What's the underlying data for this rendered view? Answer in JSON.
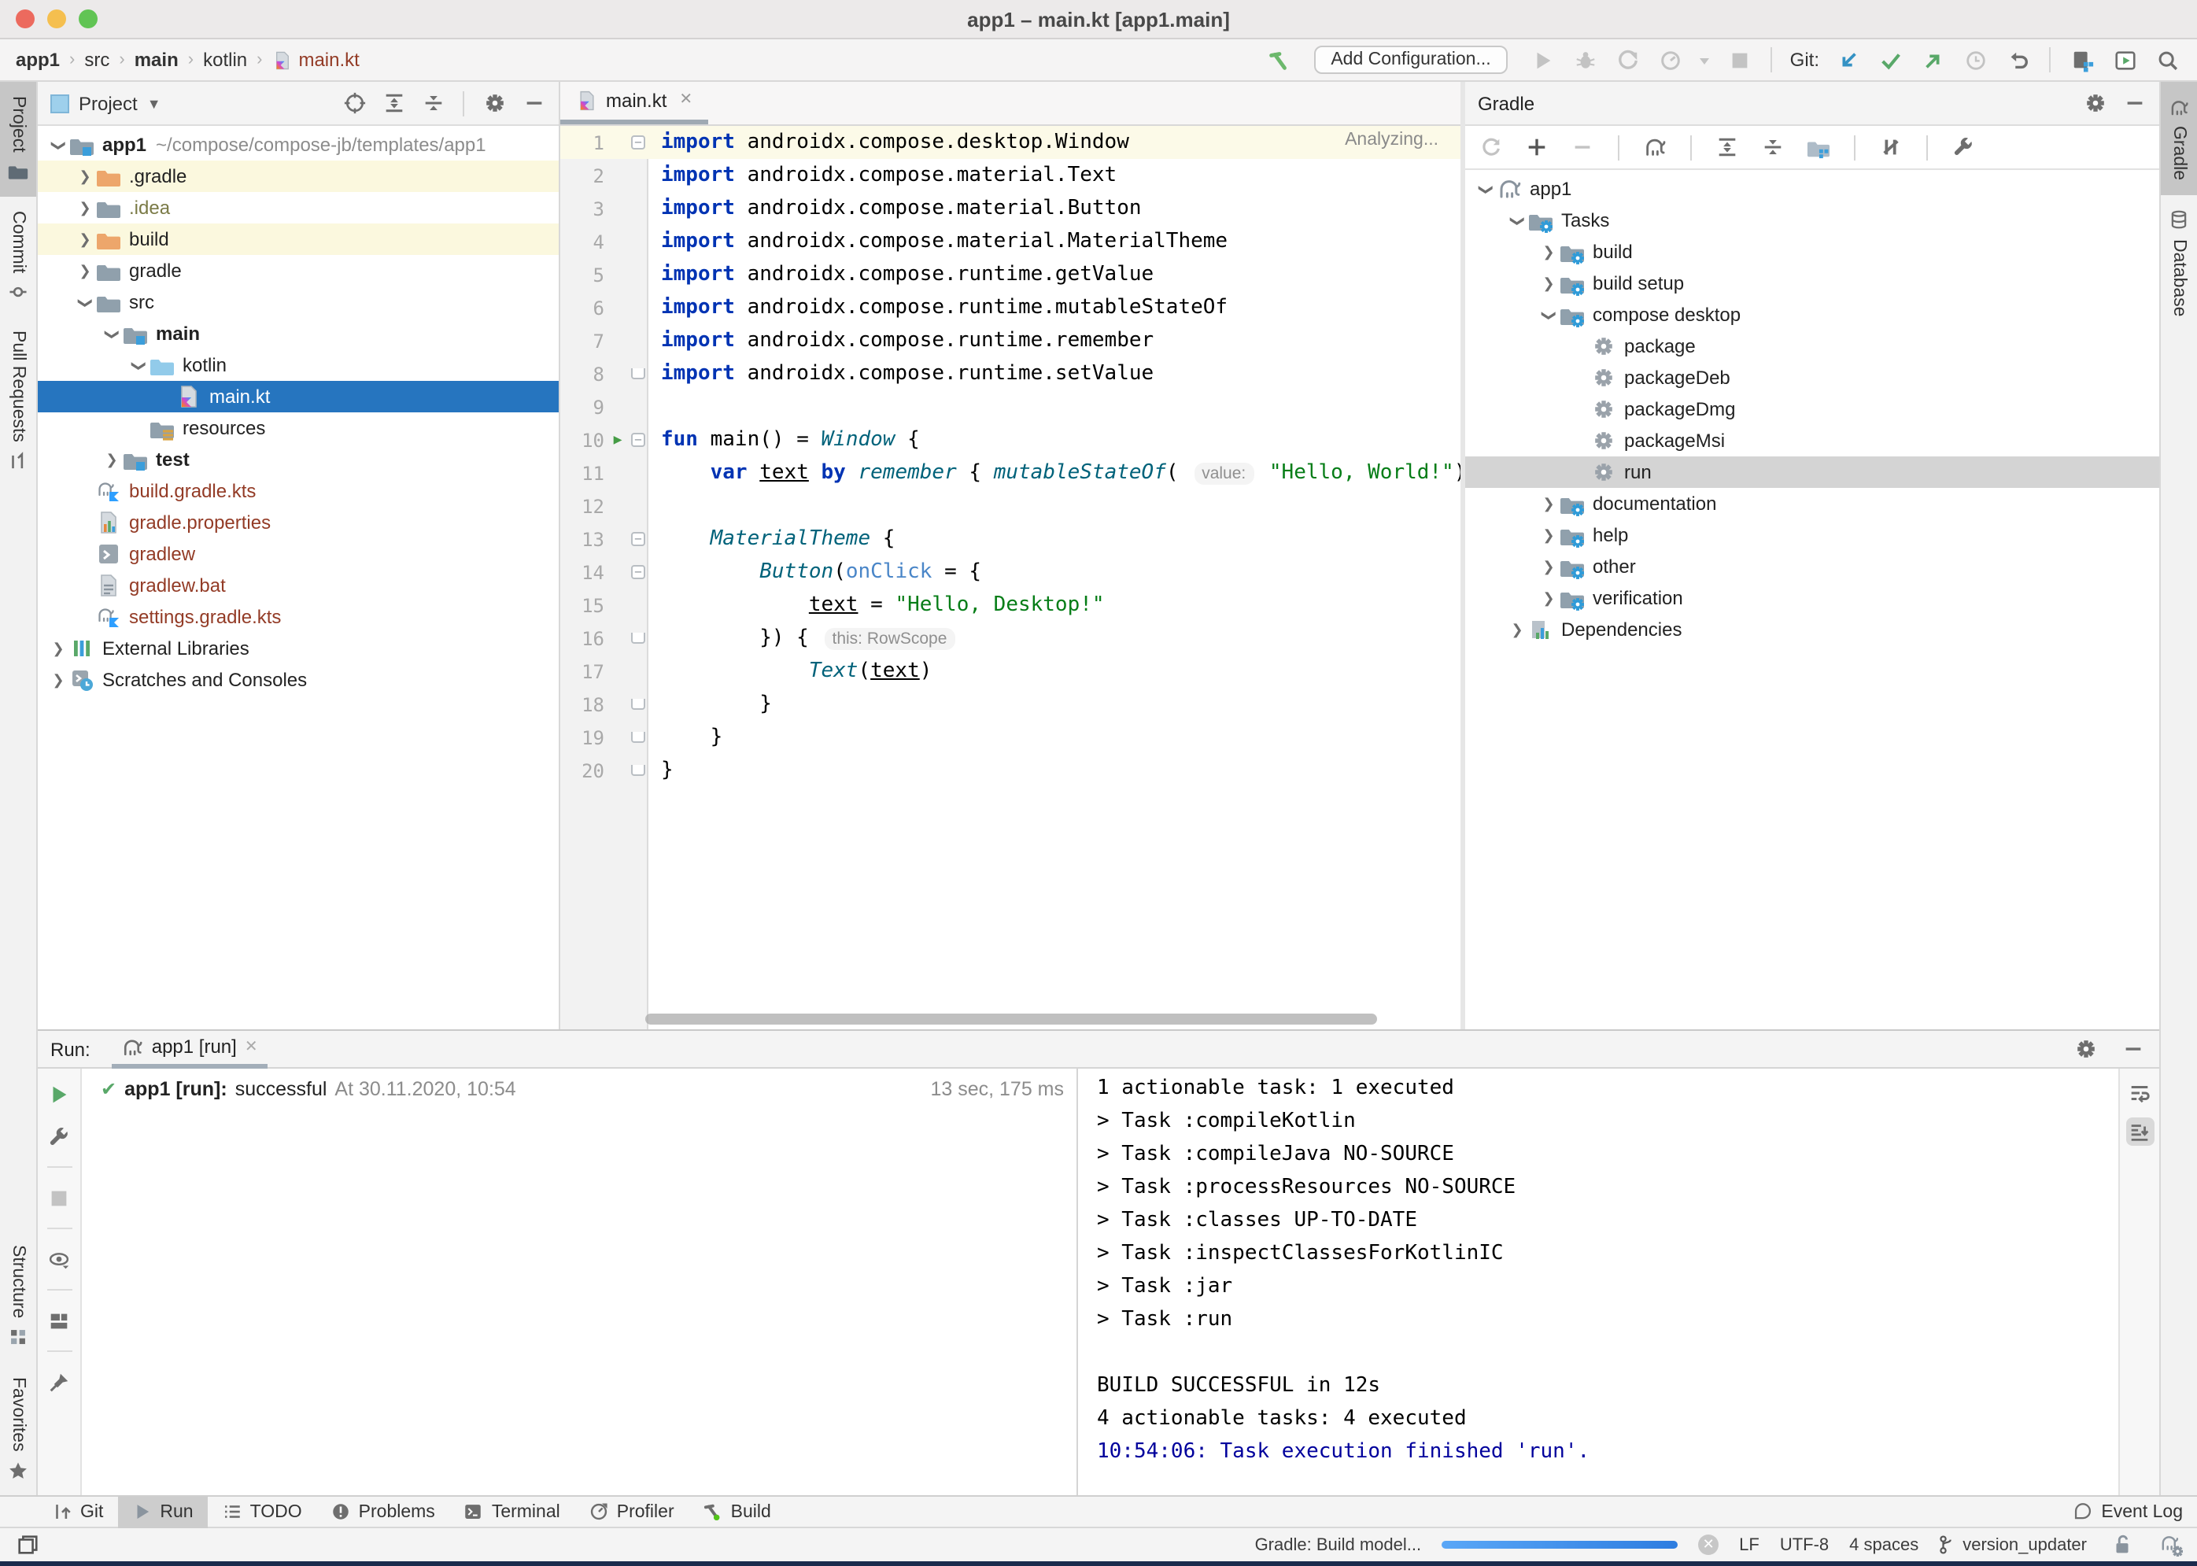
{
  "window": {
    "title": "app1 – main.kt [app1.main]"
  },
  "navbar": {
    "breadcrumbs": [
      {
        "label": "app1",
        "bold": true
      },
      {
        "label": "src",
        "bold": false
      },
      {
        "label": "main",
        "bold": true
      },
      {
        "label": "kotlin",
        "bold": false
      },
      {
        "label": "main.kt",
        "bold": false,
        "icon": "kotlin-file",
        "colored": true
      }
    ],
    "add_configuration": "Add Configuration...",
    "git_label": "Git:"
  },
  "left_stripe": {
    "top": [
      {
        "label": "Project",
        "icon": "tool-project-icon",
        "active": true
      },
      {
        "label": "Commit",
        "icon": "tool-commit-icon",
        "active": false
      },
      {
        "label": "Pull Requests",
        "icon": "tool-pr-icon",
        "active": false
      }
    ],
    "bottom": [
      {
        "label": "Structure",
        "icon": "tool-structure-icon",
        "active": false
      },
      {
        "label": "Favorites",
        "icon": "tool-star-icon",
        "active": false
      }
    ]
  },
  "right_stripe": [
    {
      "label": "Gradle",
      "icon": "gradle-elephant-icon",
      "active": true
    },
    {
      "label": "Database",
      "icon": "tool-database-icon",
      "active": false
    }
  ],
  "project_panel": {
    "title": "Project",
    "tree": [
      {
        "depth": 0,
        "chevron": "open",
        "icon": "folder-project",
        "label": "app1",
        "bold": true,
        "suffix": "~/compose/compose-jb/templates/app1"
      },
      {
        "depth": 1,
        "chevron": "closed",
        "icon": "folder-orange",
        "label": ".gradle",
        "bg": "y"
      },
      {
        "depth": 1,
        "chevron": "closed",
        "icon": "folder-gray",
        "label": ".idea",
        "color": "olive"
      },
      {
        "depth": 1,
        "chevron": "closed",
        "icon": "folder-orange",
        "label": "build",
        "bg": "y"
      },
      {
        "depth": 1,
        "chevron": "closed",
        "icon": "folder-gray",
        "label": "gradle"
      },
      {
        "depth": 1,
        "chevron": "open",
        "icon": "folder-gray",
        "label": "src"
      },
      {
        "depth": 2,
        "chevron": "open",
        "icon": "folder-main",
        "label": "main",
        "bold": true
      },
      {
        "depth": 3,
        "chevron": "open",
        "icon": "folder-kotlin",
        "label": "kotlin"
      },
      {
        "depth": 4,
        "chevron": "none",
        "icon": "kotlin-file",
        "label": "main.kt",
        "selected": true
      },
      {
        "depth": 3,
        "chevron": "none",
        "icon": "folder-resources",
        "label": "resources"
      },
      {
        "depth": 2,
        "chevron": "closed",
        "icon": "folder-main",
        "label": "test",
        "bold": true
      },
      {
        "depth": 1,
        "chevron": "none",
        "icon": "gradle-kts-file",
        "label": "build.gradle.kts",
        "color": "brick"
      },
      {
        "depth": 1,
        "chevron": "none",
        "icon": "properties-file",
        "label": "gradle.properties",
        "color": "brick"
      },
      {
        "depth": 1,
        "chevron": "none",
        "icon": "console-file",
        "label": "gradlew",
        "color": "brick"
      },
      {
        "depth": 1,
        "chevron": "none",
        "icon": "text-file",
        "label": "gradlew.bat",
        "color": "brick"
      },
      {
        "depth": 1,
        "chevron": "none",
        "icon": "gradle-kts-file",
        "label": "settings.gradle.kts",
        "color": "brick"
      },
      {
        "depth": 0,
        "chevron": "closed",
        "icon": "libraries",
        "label": "External Libraries"
      },
      {
        "depth": 0,
        "chevron": "closed",
        "icon": "scratches",
        "label": "Scratches and Consoles"
      }
    ]
  },
  "editor": {
    "tab": {
      "label": "main.kt",
      "icon": "kotlin-file"
    },
    "analyzing": "Analyzing...",
    "lines": [
      {
        "num": 1,
        "fold": "s",
        "current": true,
        "segs": [
          [
            "k",
            "import"
          ],
          [
            "p",
            " androidx.compose.desktop.Window"
          ]
        ]
      },
      {
        "num": 2,
        "segs": [
          [
            "k",
            "import"
          ],
          [
            "p",
            " androidx.compose.material.Text"
          ]
        ]
      },
      {
        "num": 3,
        "segs": [
          [
            "k",
            "import"
          ],
          [
            "p",
            " androidx.compose.material.Button"
          ]
        ]
      },
      {
        "num": 4,
        "segs": [
          [
            "k",
            "import"
          ],
          [
            "p",
            " androidx.compose.material.MaterialTheme"
          ]
        ]
      },
      {
        "num": 5,
        "segs": [
          [
            "k",
            "import"
          ],
          [
            "p",
            " androidx.compose.runtime.getValue"
          ]
        ]
      },
      {
        "num": 6,
        "segs": [
          [
            "k",
            "import"
          ],
          [
            "p",
            " androidx.compose.runtime.mutableStateOf"
          ]
        ]
      },
      {
        "num": 7,
        "segs": [
          [
            "k",
            "import"
          ],
          [
            "p",
            " androidx.compose.runtime.remember"
          ]
        ]
      },
      {
        "num": 8,
        "fold": "e",
        "segs": [
          [
            "k",
            "import"
          ],
          [
            "p",
            " androidx.compose.runtime.setValue"
          ]
        ]
      },
      {
        "num": 9,
        "segs": []
      },
      {
        "num": 10,
        "run": true,
        "fold": "s",
        "segs": [
          [
            "k",
            "fun"
          ],
          [
            "p",
            " main() = "
          ],
          [
            "fn",
            "Window"
          ],
          [
            "p",
            " {"
          ]
        ]
      },
      {
        "num": 11,
        "segs": [
          [
            "p",
            "    "
          ],
          [
            "k",
            "var"
          ],
          [
            "p",
            " "
          ],
          [
            "u",
            "text"
          ],
          [
            "p",
            " "
          ],
          [
            "k",
            "by"
          ],
          [
            "p",
            " "
          ],
          [
            "fn",
            "remember"
          ],
          [
            "p",
            " { "
          ],
          [
            "fn",
            "mutableStateOf"
          ],
          [
            "p",
            "( "
          ],
          [
            "chip",
            "value:"
          ],
          [
            "p",
            " "
          ],
          [
            "s",
            "\"Hello, World!\""
          ],
          [
            "p",
            ")"
          ]
        ]
      },
      {
        "num": 12,
        "segs": []
      },
      {
        "num": 13,
        "fold": "s",
        "segs": [
          [
            "p",
            "    "
          ],
          [
            "fn",
            "MaterialTheme"
          ],
          [
            "p",
            " {"
          ]
        ]
      },
      {
        "num": 14,
        "fold": "s",
        "segs": [
          [
            "p",
            "        "
          ],
          [
            "fn",
            "Button"
          ],
          [
            "p",
            "("
          ],
          [
            "np",
            "onClick"
          ],
          [
            "p",
            " = {"
          ]
        ]
      },
      {
        "num": 15,
        "segs": [
          [
            "p",
            "            "
          ],
          [
            "u",
            "text"
          ],
          [
            "p",
            " = "
          ],
          [
            "s",
            "\"Hello, Desktop!\""
          ]
        ]
      },
      {
        "num": 16,
        "fold": "e",
        "segs": [
          [
            "p",
            "        }) { "
          ],
          [
            "chip",
            "this: RowScope"
          ]
        ]
      },
      {
        "num": 17,
        "segs": [
          [
            "p",
            "            "
          ],
          [
            "fn",
            "Text"
          ],
          [
            "p",
            "("
          ],
          [
            "u",
            "text"
          ],
          [
            "p",
            ")"
          ]
        ]
      },
      {
        "num": 18,
        "fold": "e",
        "segs": [
          [
            "p",
            "        }"
          ]
        ]
      },
      {
        "num": 19,
        "fold": "e",
        "segs": [
          [
            "p",
            "    }"
          ]
        ]
      },
      {
        "num": 20,
        "fold": "e",
        "segs": [
          [
            "p",
            "}"
          ]
        ]
      }
    ]
  },
  "gradle_panel": {
    "title": "Gradle",
    "tree": [
      {
        "depth": 0,
        "chevron": "open",
        "icon": "gradle-elephant",
        "label": "app1"
      },
      {
        "depth": 1,
        "chevron": "open",
        "icon": "folder-taskgroup",
        "label": "Tasks"
      },
      {
        "depth": 2,
        "chevron": "closed",
        "icon": "folder-taskgroup",
        "label": "build"
      },
      {
        "depth": 2,
        "chevron": "closed",
        "icon": "folder-taskgroup",
        "label": "build setup"
      },
      {
        "depth": 2,
        "chevron": "open",
        "icon": "folder-taskgroup",
        "label": "compose desktop"
      },
      {
        "depth": 3,
        "chevron": "none",
        "icon": "task-gear",
        "label": "package"
      },
      {
        "depth": 3,
        "chevron": "none",
        "icon": "task-gear",
        "label": "packageDeb"
      },
      {
        "depth": 3,
        "chevron": "none",
        "icon": "task-gear",
        "label": "packageDmg"
      },
      {
        "depth": 3,
        "chevron": "none",
        "icon": "task-gear",
        "label": "packageMsi"
      },
      {
        "depth": 3,
        "chevron": "none",
        "icon": "task-gear",
        "label": "run",
        "selected_gray": true
      },
      {
        "depth": 2,
        "chevron": "closed",
        "icon": "folder-taskgroup",
        "label": "documentation"
      },
      {
        "depth": 2,
        "chevron": "closed",
        "icon": "folder-taskgroup",
        "label": "help"
      },
      {
        "depth": 2,
        "chevron": "closed",
        "icon": "folder-taskgroup",
        "label": "other"
      },
      {
        "depth": 2,
        "chevron": "closed",
        "icon": "folder-taskgroup",
        "label": "verification"
      },
      {
        "depth": 1,
        "chevron": "closed",
        "icon": "dependencies",
        "label": "Dependencies"
      }
    ]
  },
  "run_panel": {
    "label": "Run:",
    "tab": "app1 [run]",
    "summary": {
      "name": "app1 [run]:",
      "status": "successful",
      "at": "At 30.11.2020, 10:54",
      "duration": "13 sec, 175 ms"
    },
    "console": [
      {
        "text": "1 actionable task: 1 executed"
      },
      {
        "text": "> Task :compileKotlin"
      },
      {
        "text": "> Task :compileJava NO-SOURCE"
      },
      {
        "text": "> Task :processResources NO-SOURCE"
      },
      {
        "text": "> Task :classes UP-TO-DATE"
      },
      {
        "text": "> Task :inspectClassesForKotlinIC"
      },
      {
        "text": "> Task :jar"
      },
      {
        "text": "> Task :run"
      },
      {
        "text": ""
      },
      {
        "text": "BUILD SUCCESSFUL in 12s"
      },
      {
        "text": "4 actionable tasks: 4 executed"
      },
      {
        "text": "10:54:06: Task execution finished 'run'.",
        "style": "sys"
      }
    ]
  },
  "toolwindow_bar": {
    "left": [
      {
        "label": "Git",
        "icon": "tw-git-icon",
        "active": false
      },
      {
        "label": "Run",
        "icon": "tw-run-icon",
        "active": true
      },
      {
        "label": "TODO",
        "icon": "tw-todo-icon",
        "active": false
      },
      {
        "label": "Problems",
        "icon": "tw-problems-icon",
        "active": false
      },
      {
        "label": "Terminal",
        "icon": "tw-terminal-icon",
        "active": false
      },
      {
        "label": "Profiler",
        "icon": "tw-profiler-icon",
        "active": false
      },
      {
        "label": "Build",
        "icon": "tw-build-icon",
        "active": false
      }
    ],
    "right": [
      {
        "label": "Event Log",
        "icon": "event-log-icon",
        "active": false
      }
    ]
  },
  "statusbar": {
    "progress_label": "Gradle: Build model...",
    "line_ending": "LF",
    "encoding": "UTF-8",
    "indent": "4 spaces",
    "branch": "version_updater"
  }
}
